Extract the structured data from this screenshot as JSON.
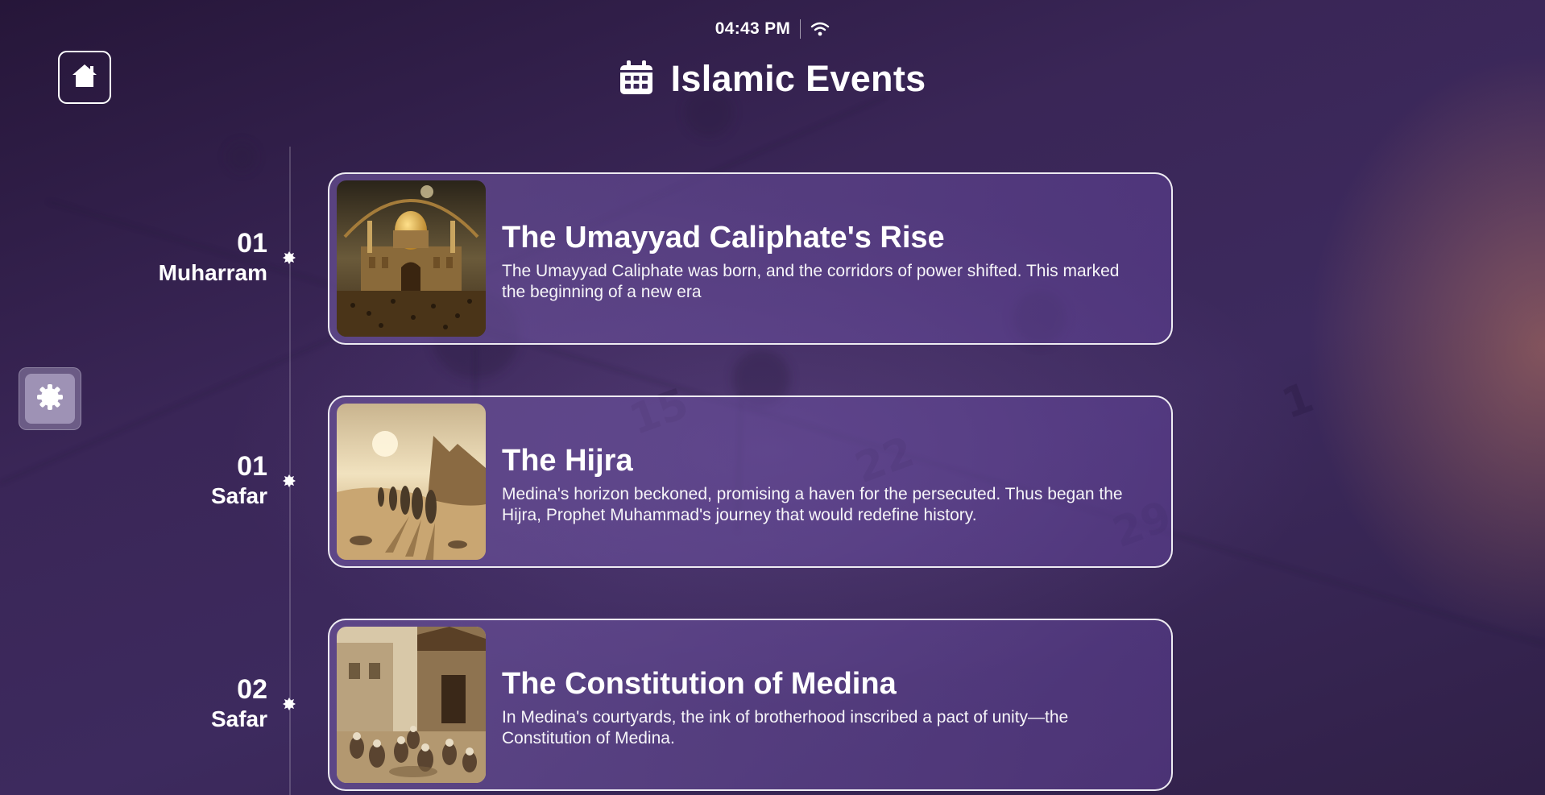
{
  "status": {
    "time": "04:43 PM",
    "wifi_icon": "wifi-icon"
  },
  "header": {
    "title": "Islamic Events",
    "icon": "calendar-icon"
  },
  "nav": {
    "home_icon": "home-icon",
    "settings_icon": "gear-icon"
  },
  "events": [
    {
      "day": "01",
      "month": "Muharram",
      "title": "The Umayyad Caliphate's Rise",
      "description": "The Umayyad Caliphate was born, and the corridors of power shifted. This marked the beginning of a new era",
      "image": "domed-mosque-illustration"
    },
    {
      "day": "01",
      "month": "Safar",
      "title": "The Hijra",
      "description": "Medina's horizon beckoned, promising a haven for the persecuted. Thus began the Hijra, Prophet Muhammad's journey that would redefine history.",
      "image": "desert-travelers-illustration"
    },
    {
      "day": "02",
      "month": "Safar",
      "title": "The Constitution of Medina",
      "description": "In Medina's courtyards, the ink of brotherhood inscribed a pact of unity—the Constitution of Medina.",
      "image": "medina-courtyard-gathering-illustration"
    }
  ],
  "colors": {
    "background": "#3a2657",
    "card_fill": "#6b4f99",
    "accent_glow": "#be785f"
  }
}
